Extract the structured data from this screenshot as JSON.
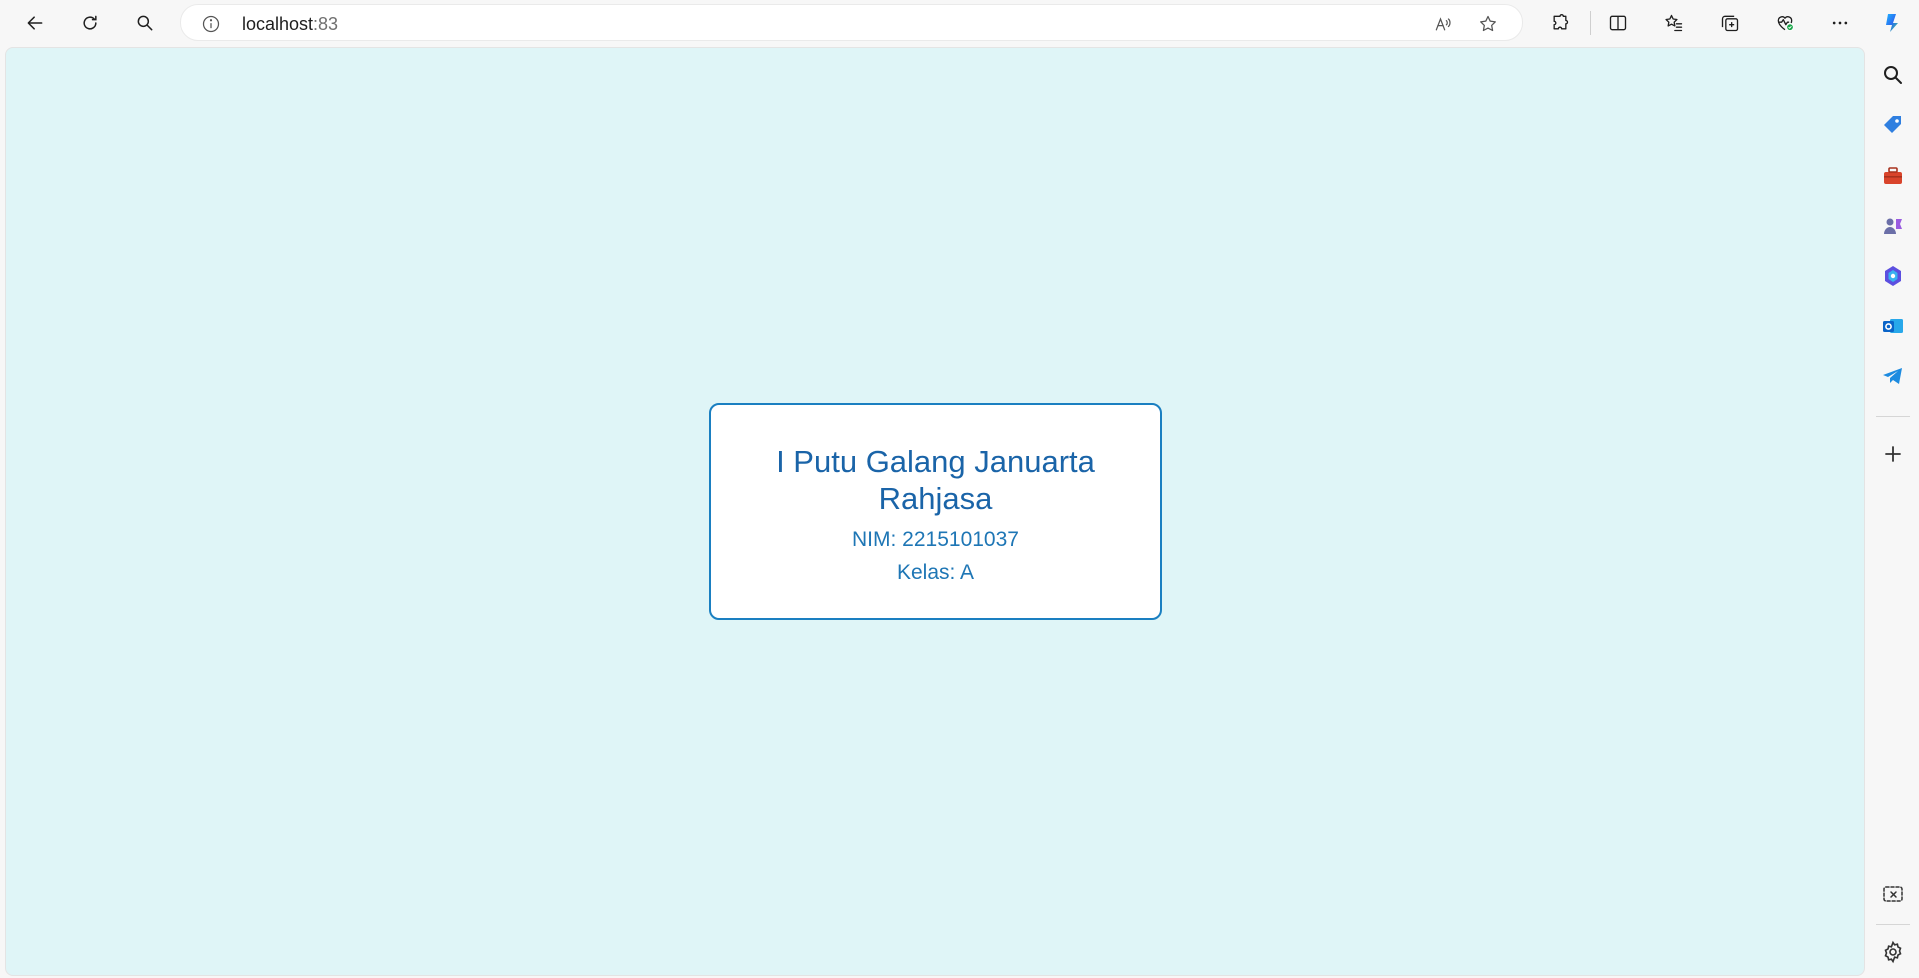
{
  "browser": {
    "url_host": "localhost",
    "url_port": ":83",
    "icons": {
      "back": "back-arrow-icon",
      "reload": "reload-icon",
      "search": "search-icon",
      "site_info": "info-icon",
      "read_aloud": "read-aloud-icon",
      "favorite": "star-icon",
      "extensions": "puzzle-icon",
      "split_screen": "split-screen-icon",
      "favorites": "favorites-list-icon",
      "collections": "collections-icon",
      "browser_essentials": "heart-pulse-icon",
      "more": "more-dots-icon",
      "copilot": "copilot-icon"
    }
  },
  "sidebar": {
    "icons": [
      "search-icon",
      "shopping-tag-icon",
      "toolbox-icon",
      "games-icon",
      "m365-icon",
      "outlook-icon",
      "telegram-icon",
      "add-icon",
      "screenshot-icon",
      "settings-icon"
    ]
  },
  "card": {
    "name": "I Putu Galang Januarta Rahjasa",
    "nim": "NIM: 2215101037",
    "kelas": "Kelas: A"
  },
  "colors": {
    "page_background": "#dff5f7",
    "card_border": "#1a7fc1",
    "card_text": "#1a64a8"
  }
}
